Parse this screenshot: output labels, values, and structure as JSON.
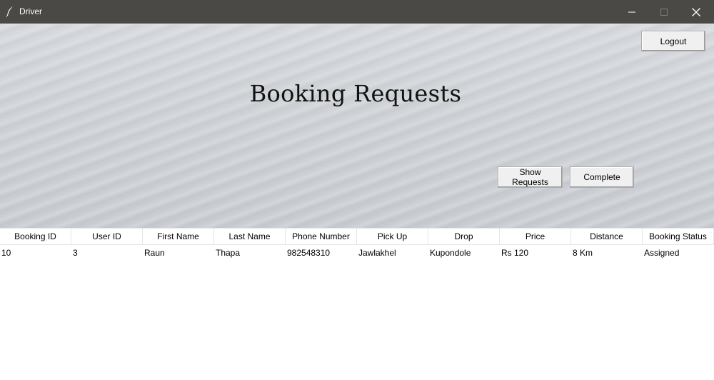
{
  "window": {
    "title": "Driver",
    "icon": "feather-icon",
    "titlebar_color": "#4a4945"
  },
  "header": {
    "title": "Booking Requests",
    "logout_label": "Logout",
    "show_requests_label": "Show Requests",
    "complete_label": "Complete"
  },
  "table": {
    "columns": [
      "Booking ID",
      "User ID",
      "First Name",
      "Last Name",
      "Phone Number",
      "Pick Up",
      "Drop",
      "Price",
      "Distance",
      "Booking Status"
    ],
    "rows": [
      [
        "10",
        "3",
        "Raun",
        "Thapa",
        "982548310",
        "Jawlakhel",
        "Kupondole",
        "Rs 120",
        "8 Km",
        "Assigned"
      ]
    ]
  }
}
